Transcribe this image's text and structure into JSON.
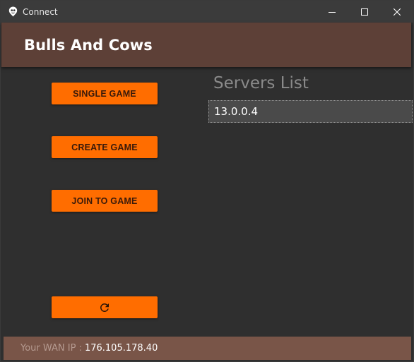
{
  "window": {
    "title": "Connect",
    "icon": "app-logo-icon",
    "controls": [
      "minimize-icon",
      "maximize-icon",
      "close-icon"
    ]
  },
  "appbar": {
    "title": "Bulls And Cows",
    "color": "#5d4037"
  },
  "buttons": {
    "single_game": "SINGLE GAME",
    "create_game": "CREATE GAME",
    "join_game": "JOIN TO GAME",
    "refresh_icon": "refresh-icon",
    "color": "#ff6d00"
  },
  "servers": {
    "heading": "Servers List",
    "items": [
      "13.0.0.4"
    ]
  },
  "footer": {
    "label": "Your WAN IP :",
    "value": "176.105.178.40",
    "color": "#795548"
  }
}
